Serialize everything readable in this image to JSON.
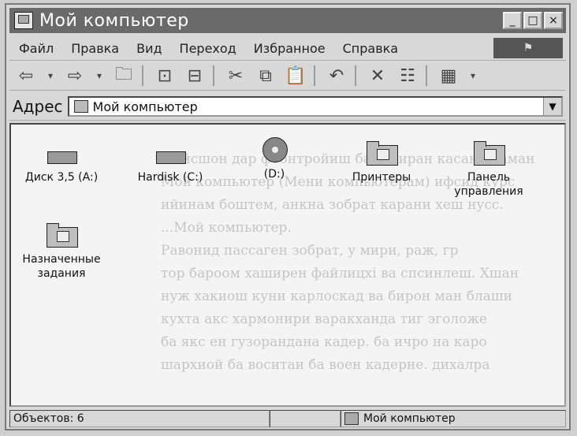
{
  "window": {
    "title": "Мой компьютер"
  },
  "title_buttons": [
    "_",
    "□",
    "×"
  ],
  "menu": [
    "Файл",
    "Правка",
    "Вид",
    "Переход",
    "Избранное",
    "Справка"
  ],
  "address": {
    "label": "Адрес",
    "value": "Мой компьютер"
  },
  "items": [
    {
      "label": "Диск 3,5 (A:)",
      "icon": "floppy-drive-icon"
    },
    {
      "label": "Hardisk (C:)",
      "icon": "hard-disk-icon"
    },
    {
      "label": "(D:)",
      "icon": "cd-drive-icon"
    },
    {
      "label": "Принтеры",
      "icon": "printers-folder-icon"
    },
    {
      "label": "Панель управления",
      "icon": "control-panel-icon"
    },
    {
      "label": "Назначенные задания",
      "icon": "scheduled-tasks-icon"
    }
  ],
  "background_text": [
    "...ойсшон дар фоонтройиш ба хотиран касани каман",
    "Мой компьютер (Мени компьютерам) ифсид курс",
    "ийинам боштем, анкна зобрат карани хеш нусс.",
    "...Мой компьютер.",
    "Равонид пассаген зобрат, у мири, раж, гр",
    "тор бароом хаширен файлицхі ва спсинлеш. Хшан",
    "нуж хакиош куни карлоскад ва бирон ман блаши",
    "кухта акс хармонири варакханда тиг эголоже",
    "ба якс ен гузорандана кадер. ба ичро на каро",
    "шархиой ба воситаи ба воен кадерне. дихалра"
  ],
  "statusbar": {
    "objects": "Объектов: 6",
    "location": "Мой компьютер"
  }
}
